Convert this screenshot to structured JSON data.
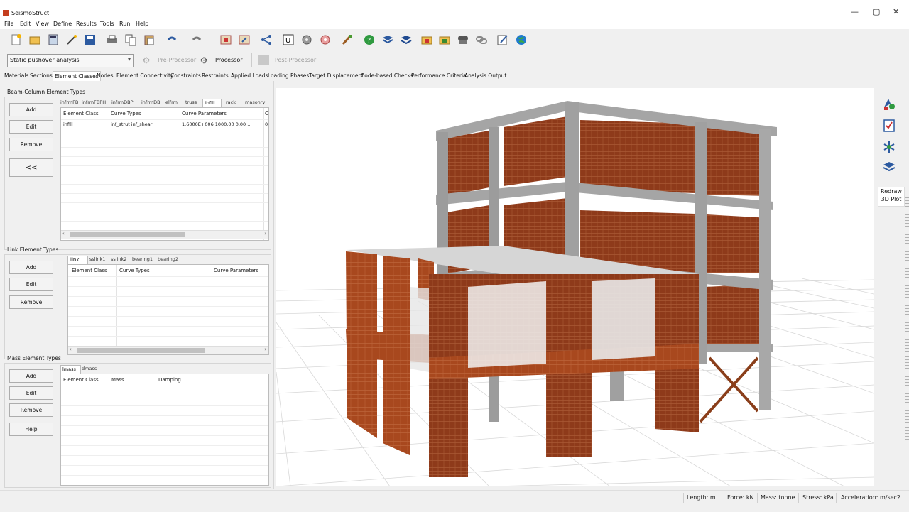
{
  "window": {
    "title": "SeismoStruct",
    "minimize": "—",
    "maximize": "▢",
    "close": "✕"
  },
  "menu": [
    "File",
    "Edit",
    "View",
    "Define",
    "Results",
    "Tools",
    "Run",
    "Help"
  ],
  "toolbar_icons": [
    "new-file-icon",
    "open-folder-icon",
    "calculator-icon",
    "wizard-icon",
    "save-icon",
    "print-icon",
    "copy-icon",
    "paste-icon",
    "undo-icon",
    "redo-icon",
    "import-icon",
    "export-icon",
    "connect-icon",
    "u-units-icon",
    "gear-icon",
    "settings-icon",
    "brush-icon",
    "help-icon",
    "book-icon",
    "book-blue-icon",
    "folder-icon",
    "folder-yellow-icon",
    "film-icon",
    "chain-icon",
    "edit-icon",
    "globe-icon"
  ],
  "analysis": {
    "type": "Static pushover analysis",
    "pre_processor": "Pre-Processor",
    "processor": "Processor",
    "post_processor": "Post-Processor"
  },
  "main_tabs": [
    "Materials",
    "Sections",
    "Element Classes",
    "Nodes",
    "Element Connectivity",
    "Constraints",
    "Restraints",
    "Applied Loads",
    "Loading Phases",
    "Target Displacement",
    "Code-based Checks",
    "Performance Criteria",
    "Analysis Output"
  ],
  "active_main_tab": "Element Classes",
  "beam_column": {
    "title": "Beam-Column Element Types",
    "buttons": {
      "add": "Add",
      "edit": "Edit",
      "remove": "Remove",
      "collapse": "<<"
    },
    "tabs": [
      "infrmFB",
      "infrmFBPH",
      "infrmDBPH",
      "infrmDB",
      "elfrm",
      "truss",
      "infill",
      "rack",
      "masonry"
    ],
    "active_tab": "infill",
    "columns": [
      "Element Class",
      "Curve Types",
      "Curve Parameters",
      "C"
    ],
    "rows": [
      {
        "class": "infill",
        "curve_types": "inf_strut   inf_shear",
        "curve_parameters": "1.6000E+006   1000.00   0.00 ...",
        "c": "0"
      }
    ]
  },
  "link": {
    "title": "Link Element Types",
    "buttons": {
      "add": "Add",
      "edit": "Edit",
      "remove": "Remove"
    },
    "tabs": [
      "link",
      "sslink1",
      "sslink2",
      "bearing1",
      "bearing2"
    ],
    "active_tab": "link",
    "columns": [
      "Element Class",
      "Curve Types",
      "Curve Parameters"
    ]
  },
  "mass": {
    "title": "Mass Element Types",
    "buttons": {
      "add": "Add",
      "edit": "Edit",
      "remove": "Remove",
      "help": "Help"
    },
    "tabs": [
      "lmass",
      "dmass"
    ],
    "active_tab": "lmass",
    "columns": [
      "Element Class",
      "Mass",
      "Damping"
    ]
  },
  "right_tools": [
    "shapes-icon",
    "checklist-icon",
    "asterisk-icon",
    "layers-icon"
  ],
  "redraw": {
    "line1": "Redraw",
    "line2": "3D Plot"
  },
  "status": {
    "length": "Length: m",
    "force": "Force: kN",
    "mass": "Mass: tonne",
    "stress": "Stress: kPa",
    "acceleration": "Acceleration: m/sec2"
  },
  "colors": {
    "brick": "#9a3d1a",
    "steel": "#a9a9a9",
    "accent": "#0078d7"
  }
}
